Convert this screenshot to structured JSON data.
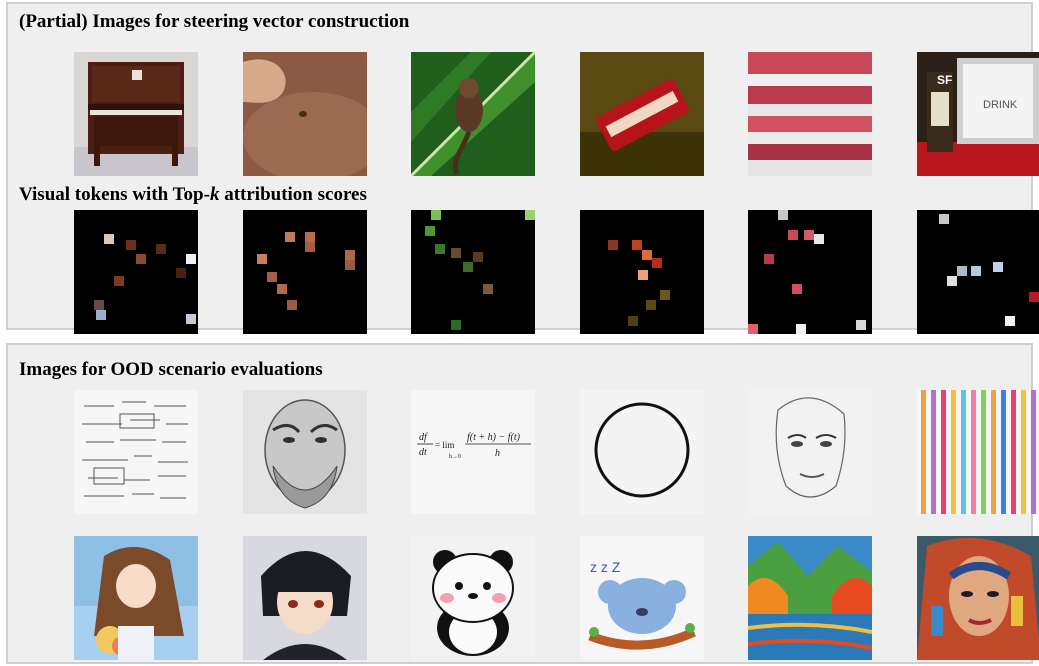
{
  "sections": [
    {
      "title": "(Partial) Images for steering vector construction",
      "subtitle_prefix": "Visual tokens with Top-",
      "subtitle_var": "k",
      "subtitle_suffix": " attribution scores",
      "images": [
        "piano",
        "hand",
        "monkey",
        "snack-bag",
        "shelf",
        "drink-sign"
      ],
      "token_images": [
        "piano-tokens",
        "hand-tokens",
        "monkey-tokens",
        "snack-bag-tokens",
        "shelf-tokens",
        "drink-sign-tokens"
      ],
      "sign_text": {
        "logo": "SF",
        "title": "DRINK"
      }
    },
    {
      "title": "Images for OOD scenario evaluations",
      "images": [
        "math-notes",
        "old-man-sketch",
        "derivative-formula",
        "circle",
        "woman-sketch",
        "color-stripes",
        "anime-girl",
        "anime-boy",
        "panda",
        "sleeping-koala",
        "landscape-painting",
        "woman-portrait"
      ],
      "formula": {
        "lhs_num": "df",
        "lhs_den": "dt",
        "eq": "= lim",
        "lim_sub": "h→0",
        "rhs_num": "f(t + h) − f(t)",
        "rhs_den": "h"
      },
      "sleep_text": "z z Z"
    }
  ]
}
